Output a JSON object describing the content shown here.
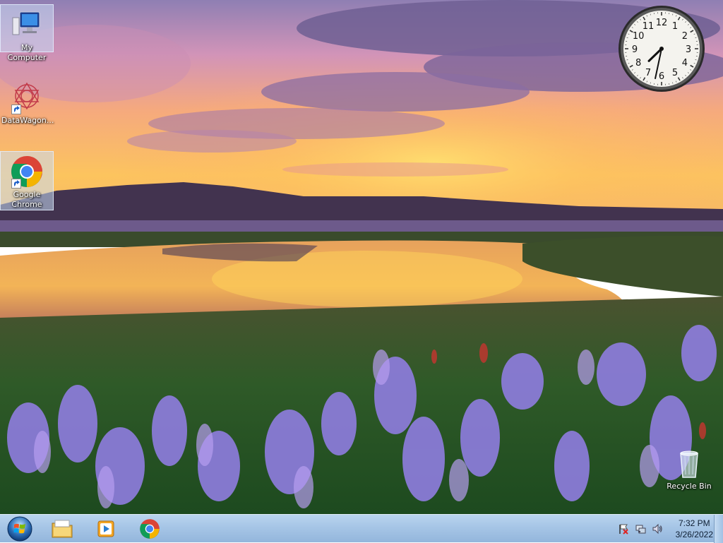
{
  "desktop": {
    "icons": [
      {
        "label": "My Computer",
        "icon": "computer-icon",
        "selected": true
      },
      {
        "label": "DataWagon...",
        "icon": "datawagon-icon",
        "selected": false
      },
      {
        "label": "Google Chrome",
        "icon": "chrome-icon",
        "selected": true
      },
      {
        "label": "Recycle Bin",
        "icon": "recycle-bin-icon",
        "selected": false
      }
    ],
    "clock_gadget": {
      "numerals": [
        "12",
        "1",
        "2",
        "3",
        "4",
        "5",
        "6",
        "7",
        "8",
        "9",
        "10",
        "11"
      ],
      "hour": 7,
      "minute": 32
    }
  },
  "taskbar": {
    "start_icon": "windows-orb-icon",
    "pinned": [
      {
        "name": "windows-explorer",
        "icon": "folder-icon"
      },
      {
        "name": "media-player",
        "icon": "media-player-icon"
      },
      {
        "name": "google-chrome",
        "icon": "chrome-icon"
      }
    ],
    "tray": {
      "icons": [
        "action-center-flag-icon",
        "network-icon",
        "volume-icon"
      ],
      "time": "7:32 PM",
      "date": "3/26/2022"
    }
  },
  "colors": {
    "taskbar_top": "#b9d4ee",
    "taskbar_bottom": "#93b6dc",
    "sky_top": "#9f86b8",
    "sun": "#ffd24a"
  }
}
